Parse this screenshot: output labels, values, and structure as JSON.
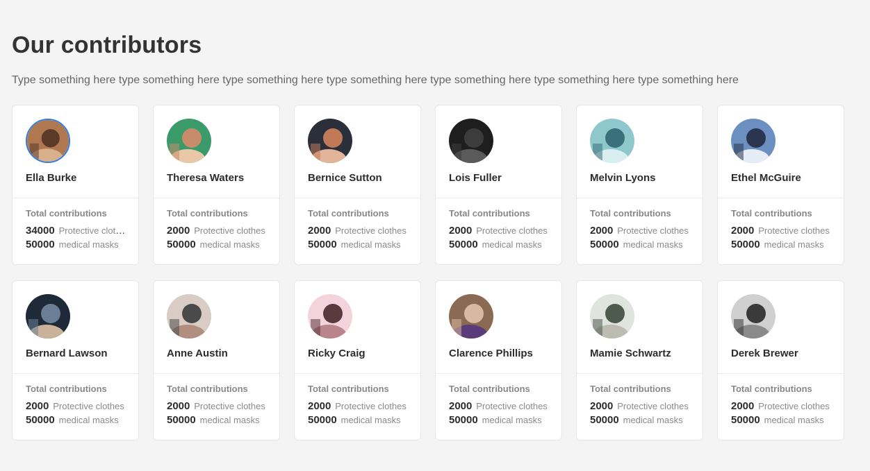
{
  "page": {
    "title": "Our contributors",
    "subtitle": "Type something here type something here type something here type something here type something here type something here type something here"
  },
  "contributors": [
    {
      "name": "Ella Burke",
      "label": "Total contributions",
      "clothes": "34000",
      "clothes_unit": "Protective clothes",
      "masks": "50000",
      "masks_unit": "medical masks",
      "avatar": "crowd-photo",
      "selected": true
    },
    {
      "name": "Theresa Waters",
      "label": "Total contributions",
      "clothes": "2000",
      "clothes_unit": "Protective clothes",
      "masks": "50000",
      "masks_unit": "medical masks",
      "avatar": "portrait-photo"
    },
    {
      "name": "Bernice Sutton",
      "label": "Total contributions",
      "clothes": "2000",
      "clothes_unit": "Protective clothes",
      "masks": "50000",
      "masks_unit": "medical masks",
      "avatar": "two-women-photo"
    },
    {
      "name": "Lois Fuller",
      "label": "Total contributions",
      "clothes": "2000",
      "clothes_unit": "Protective clothes",
      "masks": "50000",
      "masks_unit": "medical masks",
      "avatar": "dark-portrait-photo"
    },
    {
      "name": "Melvin Lyons",
      "label": "Total contributions",
      "clothes": "2000",
      "clothes_unit": "Protective clothes",
      "masks": "50000",
      "masks_unit": "medical masks",
      "avatar": "street-photo"
    },
    {
      "name": "Ethel McGuire",
      "label": "Total contributions",
      "clothes": "2000",
      "clothes_unit": "Protective clothes",
      "masks": "50000",
      "masks_unit": "medical masks",
      "avatar": "concert-photo"
    },
    {
      "name": "Bernard Lawson",
      "label": "Total contributions",
      "clothes": "2000",
      "clothes_unit": "Protective clothes",
      "masks": "50000",
      "masks_unit": "medical masks",
      "avatar": "crowd-dark-photo"
    },
    {
      "name": "Anne Austin",
      "label": "Total contributions",
      "clothes": "2000",
      "clothes_unit": "Protective clothes",
      "masks": "50000",
      "masks_unit": "medical masks",
      "avatar": "walkers-photo"
    },
    {
      "name": "Ricky Craig",
      "label": "Total contributions",
      "clothes": "2000",
      "clothes_unit": "Protective clothes",
      "masks": "50000",
      "masks_unit": "medical masks",
      "avatar": "pink-portrait-photo"
    },
    {
      "name": "Clarence Phillips",
      "label": "Total contributions",
      "clothes": "2000",
      "clothes_unit": "Protective clothes",
      "masks": "50000",
      "masks_unit": "medical masks",
      "avatar": "elder-portrait-photo"
    },
    {
      "name": "Mamie Schwartz",
      "label": "Total contributions",
      "clothes": "2000",
      "clothes_unit": "Protective clothes",
      "masks": "50000",
      "masks_unit": "medical masks",
      "avatar": "rock-beach-photo"
    },
    {
      "name": "Derek Brewer",
      "label": "Total contributions",
      "clothes": "2000",
      "clothes_unit": "Protective clothes",
      "masks": "50000",
      "masks_unit": "medical masks",
      "avatar": "bw-family-photo"
    }
  ],
  "avatar_colors": {
    "crowd-photo": [
      "#b07850",
      "#5c3a2a",
      "#d9b08c"
    ],
    "portrait-photo": [
      "#3a9a6a",
      "#c98c6a",
      "#e9c8a8"
    ],
    "two-women-photo": [
      "#2a2f3a",
      "#c07a58",
      "#e2b59a"
    ],
    "dark-portrait-photo": [
      "#1e1e1e",
      "#3c3c3c",
      "#5a5a5a"
    ],
    "street-photo": [
      "#8fc8cc",
      "#3b6f7a",
      "#d9eef0"
    ],
    "concert-photo": [
      "#6a8fc0",
      "#2a3650",
      "#e6ecf6"
    ],
    "crowd-dark-photo": [
      "#1e2a38",
      "#6a7f95",
      "#c9b19a"
    ],
    "walkers-photo": [
      "#d9ccc4",
      "#4a4a4a",
      "#b08f80"
    ],
    "pink-portrait-photo": [
      "#f3d3dc",
      "#5a3a3e",
      "#b9848c"
    ],
    "elder-portrait-photo": [
      "#8a6a52",
      "#d8b8a0",
      "#5a3c7a"
    ],
    "rock-beach-photo": [
      "#dfe4df",
      "#4e5a4e",
      "#bcbcb0"
    ],
    "bw-family-photo": [
      "#d0d0d0",
      "#3a3a3a",
      "#8a8a8a"
    ]
  },
  "accent_color": "#2f7de1"
}
